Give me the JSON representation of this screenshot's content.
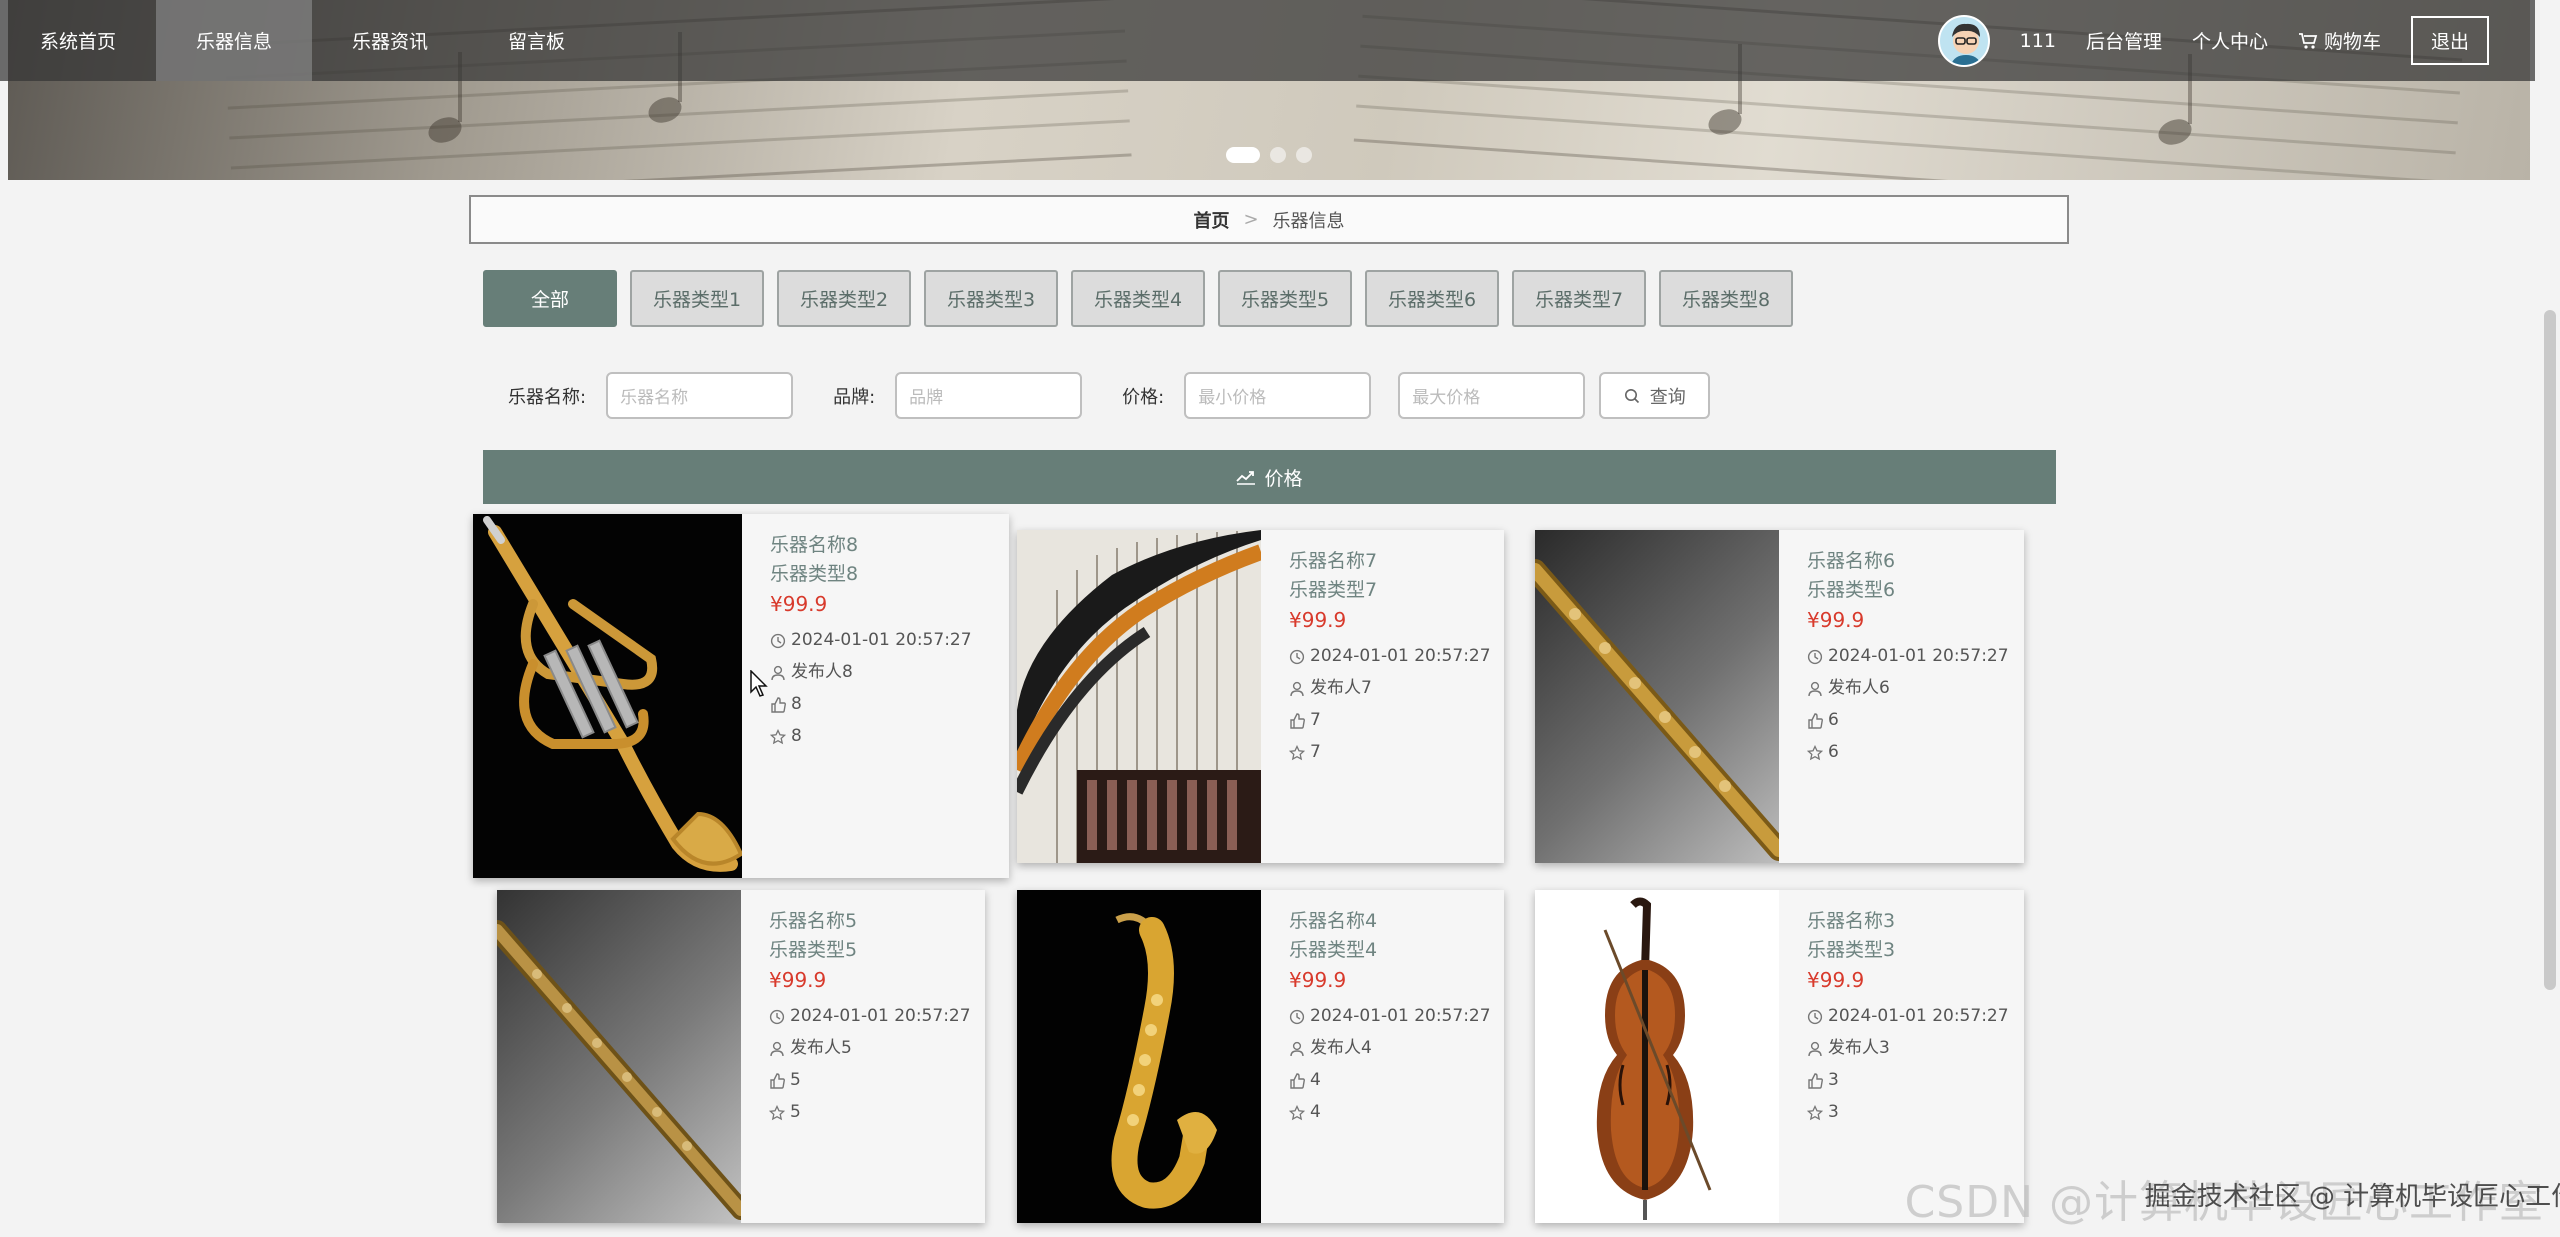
{
  "nav": {
    "items": [
      "系统首页",
      "乐器信息",
      "乐器资讯",
      "留言板"
    ],
    "active_index": 1,
    "username": "111",
    "admin_link": "后台管理",
    "profile_link": "个人中心",
    "cart_link": "购物车",
    "logout_label": "退出"
  },
  "banner": {
    "slide_count": 3,
    "active_slide": 0
  },
  "breadcrumb": {
    "home": "首页",
    "separator": ">",
    "current": "乐器信息"
  },
  "categories": [
    "全部",
    "乐器类型1",
    "乐器类型2",
    "乐器类型3",
    "乐器类型4",
    "乐器类型5",
    "乐器类型6",
    "乐器类型7",
    "乐器类型8"
  ],
  "search": {
    "name_label": "乐器名称:",
    "name_placeholder": "乐器名称",
    "brand_label": "品牌:",
    "brand_placeholder": "品牌",
    "price_label": "价格:",
    "min_placeholder": "最小价格",
    "max_placeholder": "最大价格",
    "button_label": "查询"
  },
  "sort": {
    "label": "价格"
  },
  "products": [
    {
      "name": "乐器名称8",
      "type": "乐器类型8",
      "price": "¥99.9",
      "time": "2024-01-01 20:57:27",
      "publisher": "发布人8",
      "likes": "8",
      "favorites": "8",
      "image": "trumpet"
    },
    {
      "name": "乐器名称7",
      "type": "乐器类型7",
      "price": "¥99.9",
      "time": "2024-01-01 20:57:27",
      "publisher": "发布人7",
      "likes": "7",
      "favorites": "7",
      "image": "harp"
    },
    {
      "name": "乐器名称6",
      "type": "乐器类型6",
      "price": "¥99.9",
      "time": "2024-01-01 20:57:27",
      "publisher": "发布人6",
      "likes": "6",
      "favorites": "6",
      "image": "soprano-sax"
    },
    {
      "name": "乐器名称5",
      "type": "乐器类型5",
      "price": "¥99.9",
      "time": "2024-01-01 20:57:27",
      "publisher": "发布人5",
      "likes": "5",
      "favorites": "5",
      "image": "soprano-sax"
    },
    {
      "name": "乐器名称4",
      "type": "乐器类型4",
      "price": "¥99.9",
      "time": "2024-01-01 20:57:27",
      "publisher": "发布人4",
      "likes": "4",
      "favorites": "4",
      "image": "saxophone"
    },
    {
      "name": "乐器名称3",
      "type": "乐器类型3",
      "price": "¥99.9",
      "time": "2024-01-01 20:57:27",
      "publisher": "发布人3",
      "likes": "3",
      "favorites": "3",
      "image": "cello"
    }
  ],
  "watermark": {
    "text": "CSDN @计算机毕设匠心工作室",
    "overlay": "掘金技术社区 @ 计算机毕设匠心工作室"
  },
  "colors": {
    "accent": "#677e78",
    "price": "#d83a2c",
    "nav_bg": "#343434"
  }
}
